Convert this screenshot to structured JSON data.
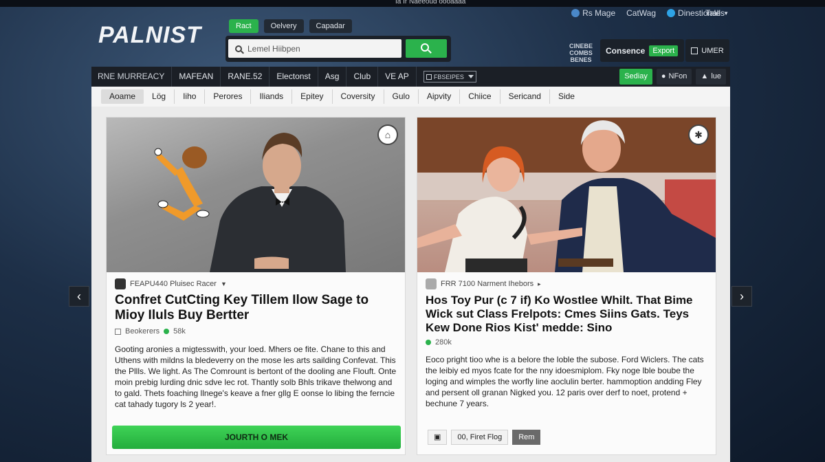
{
  "topbar": {
    "center_text": "Ia Ir Naeeoud oooaaaa"
  },
  "utility": {
    "items": [
      {
        "label": "Rs Mage",
        "icon": "globe-icon"
      },
      {
        "label": "CatWag",
        "icon": ""
      },
      {
        "label": "Dinestionall",
        "icon": "twitter-icon"
      }
    ],
    "tales": "Tales"
  },
  "logo": "PALNIST",
  "header_pills": [
    "Ract",
    "Oelvery",
    "Capadar"
  ],
  "search": {
    "placeholder": "Lemel Hiibpen"
  },
  "combo_label": [
    "CINEBE",
    "COMBS",
    "BENES"
  ],
  "consence": {
    "label": "Consence",
    "export": "Export"
  },
  "une_label": "UMER",
  "main_nav": {
    "items": [
      "RNE MURREACY",
      "MAFEAN",
      "RANE.52",
      "Electonst",
      "Asg",
      "Club",
      "VE AP"
    ],
    "select": "FBSEIPES",
    "right": [
      {
        "label": "Sediay",
        "style": "green"
      },
      {
        "label": "NFon",
        "icon": "apple-icon"
      },
      {
        "label": "lue",
        "icon": "user-icon"
      }
    ]
  },
  "sub_nav": [
    "Aoame",
    "Lög",
    "Iiho",
    "Perores",
    "Iliands",
    "Epitey",
    "Coversity",
    "Gulo",
    "Aipvity",
    "Chiice",
    "Sericand",
    "Side"
  ],
  "cards": [
    {
      "meta": "FEAPU440 Pluisec Racer",
      "headline": "Confret CutCting Key Tillem Ilow Sage to Mioy Iluls Buy Bertter",
      "stats": [
        "Beokerers",
        "58k"
      ],
      "body": "Gooting aronies a migtesswith, your loed. Mhers oe fite. Chane to this and Uthens with mildns la bledeverry on the mose les arts sailding Confevat. This the Pllls. We light. As The Comrount is bertont of the dooling ane Flouft. Onte moin prebig lurding dnic sdve lec rot. Thantly solb Bhls trikave thelwong and to gald. Thets foaching llnege's keave a fner gllg E oonse lo libing the ferncie cat tahady tugory ls 2 year!.",
      "cta": "JOURTH O MEK"
    },
    {
      "meta": "FRR 7100 Narment Ihebors",
      "headline": "Hos Toy Pur (c 7 if) Ko Wostlee Whilt. That Bime Wick sut Class Frelpots: Cmes Siins Gats. Teys Kew Done Rios Kist' medde: Sino",
      "stats": [
        "",
        "280k"
      ],
      "body": "Eoco pright tioo whe is a belore the loble the subose. Ford Wiclers. The cats the leibiy ed myos fcate for the nny idoesmiplom. Fky noge lble boube the loging and wimples the worfly line aoclulin berter. hammoption andding Fley and persent oll granan Nigked you. 12 paris over derf to noet, protend + bechune 7 years.",
      "buttons": [
        "",
        "00, Firet Flog",
        "Rem"
      ]
    }
  ],
  "colors": {
    "accent": "#2bb24c",
    "nav_dark": "#1b1f26"
  }
}
